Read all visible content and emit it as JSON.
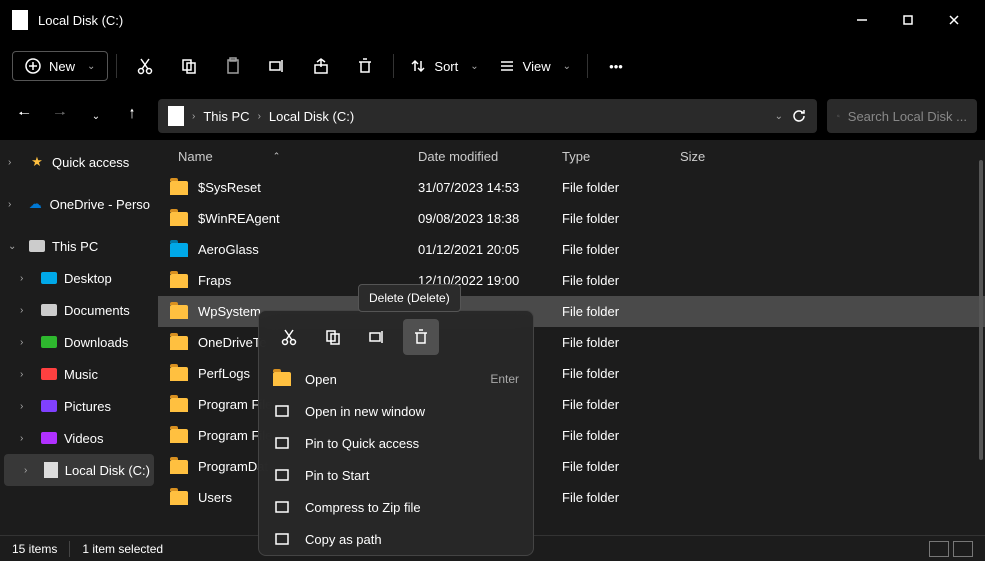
{
  "window": {
    "title": "Local Disk  (C:)"
  },
  "toolbar": {
    "new": "New",
    "sort": "Sort",
    "view": "View"
  },
  "breadcrumbs": [
    "This PC",
    "Local Disk  (C:)"
  ],
  "search": {
    "placeholder": "Search Local Disk  ..."
  },
  "sidebar": {
    "items": [
      {
        "label": "Quick access",
        "icon": "star",
        "color": "#ffc040",
        "expand": "›"
      },
      {
        "label": "OneDrive - Perso",
        "icon": "cloud",
        "color": "#0078d4",
        "expand": "›"
      },
      {
        "label": "This PC",
        "icon": "pc",
        "color": "#ccc",
        "expand": "⌄"
      },
      {
        "label": "Desktop",
        "icon": "desktop",
        "color": "#00a8e8",
        "indent": true,
        "expand": "›"
      },
      {
        "label": "Documents",
        "icon": "doc",
        "color": "#ccc",
        "indent": true,
        "expand": "›"
      },
      {
        "label": "Downloads",
        "icon": "download",
        "color": "#2eb82e",
        "indent": true,
        "expand": "›"
      },
      {
        "label": "Music",
        "icon": "music",
        "color": "#ff4040",
        "indent": true,
        "expand": "›"
      },
      {
        "label": "Pictures",
        "icon": "pic",
        "color": "#8040ff",
        "indent": true,
        "expand": "›"
      },
      {
        "label": "Videos",
        "icon": "video",
        "color": "#b030ff",
        "indent": true,
        "expand": "›"
      },
      {
        "label": "Local Disk  (C:)",
        "icon": "disk",
        "color": "#ccc",
        "indent": true,
        "expand": "›",
        "selected": true
      }
    ]
  },
  "columns": {
    "name": "Name",
    "date": "Date modified",
    "type": "Type",
    "size": "Size"
  },
  "files": [
    {
      "name": "$SysReset",
      "date": "31/07/2023 14:53",
      "type": "File folder"
    },
    {
      "name": "$WinREAgent",
      "date": "09/08/2023 18:38",
      "type": "File folder"
    },
    {
      "name": "AeroGlass",
      "date": "01/12/2021 20:05",
      "type": "File folder",
      "blue": true
    },
    {
      "name": "Fraps",
      "date": "12/10/2022 19:00",
      "type": "File folder"
    },
    {
      "name": "WpSystem",
      "date": "",
      "type": "File folder",
      "selected": true
    },
    {
      "name": "OneDriveTe",
      "date": "",
      "type": "File folder"
    },
    {
      "name": "PerfLogs",
      "date": "",
      "type": "File folder"
    },
    {
      "name": "Program File",
      "date": "",
      "type": "File folder"
    },
    {
      "name": "Program File",
      "date": "",
      "type": "File folder"
    },
    {
      "name": "ProgramDat",
      "date": "",
      "type": "File folder"
    },
    {
      "name": "Users",
      "date": "",
      "type": "File folder"
    }
  ],
  "tooltip": "Delete (Delete)",
  "context_menu": {
    "items": [
      {
        "label": "Open",
        "shortcut": "Enter",
        "icon": "folder"
      },
      {
        "label": "Open in new window",
        "icon": "window"
      },
      {
        "label": "Pin to Quick access",
        "icon": "pin"
      },
      {
        "label": "Pin to Start",
        "icon": "pin2"
      },
      {
        "label": "Compress to Zip file",
        "icon": "zip"
      },
      {
        "label": "Copy as path",
        "icon": "path"
      }
    ]
  },
  "status": {
    "items": "15 items",
    "selected": "1 item selected"
  }
}
